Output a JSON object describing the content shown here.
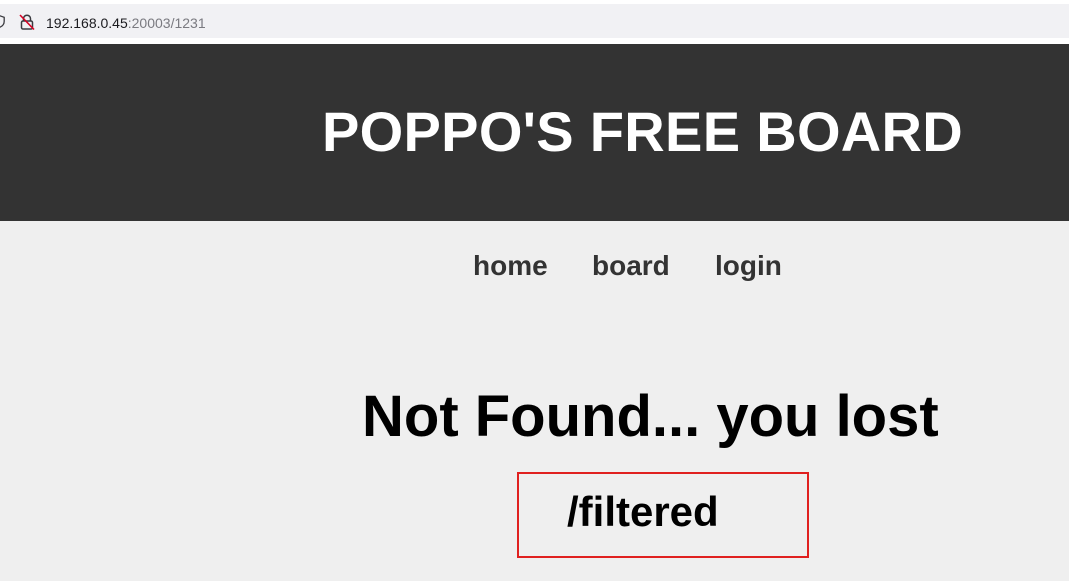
{
  "browser": {
    "url_host": "192.168.0.45",
    "url_path": ":20003/1231",
    "icons": [
      "shield-icon",
      "not-secure-lock-icon"
    ],
    "not_secure_color": "#d70022"
  },
  "header": {
    "title": "POPPO'S FREE BOARD",
    "background": "#333333"
  },
  "nav": {
    "items": [
      {
        "label": "home"
      },
      {
        "label": "board"
      },
      {
        "label": "login"
      }
    ]
  },
  "main": {
    "heading": "Not Found... you lost",
    "path": "/filtered",
    "highlight_color": "#e0201f"
  }
}
